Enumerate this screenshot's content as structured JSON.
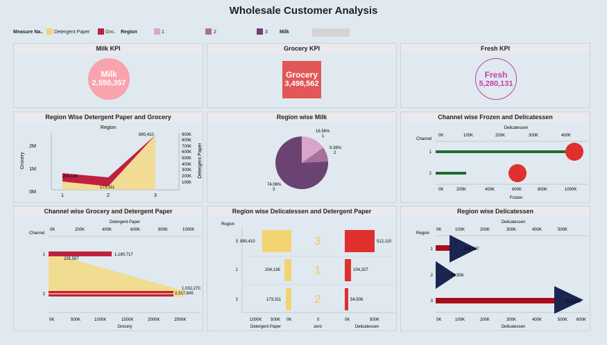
{
  "title": "Wholesale Customer Analysis",
  "legend": {
    "measure_label": "Measure Na..",
    "item1": "Detergent Paper",
    "item2": "Gro..",
    "region_label": "Region",
    "r1": "1",
    "r2": "2",
    "r3": "3",
    "milk_label": "Milk"
  },
  "colors": {
    "detergent": "#f3d473",
    "grocery": "#c0203f",
    "r1": "#d9a5c9",
    "r2": "#a9709c",
    "r3": "#6b4373",
    "milk_kpi": "#f9a3ae",
    "grocery_kpi": "#e25757",
    "fresh_kpi": "#c43ea8",
    "frozen_bar": "#1f6b2f",
    "deli_circle": "#e0302e",
    "deli_bar": "#cc3333",
    "deli_tri": "#1a2550",
    "dark_red": "#a70d1b"
  },
  "kpis": [
    {
      "header": "Milk KPI",
      "label": "Milk",
      "value": "2,550,357"
    },
    {
      "header": "Grocery KPI",
      "label": "Grocery",
      "value": "3,498,562"
    },
    {
      "header": "Fresh KPI",
      "label": "Fresh",
      "value": "5,280,131"
    }
  ],
  "panels": {
    "p4": {
      "header": "Region Wise Detergent Paper and Grocery",
      "top": "Region",
      "ylabel": "Grocery",
      "y2label": "Detergent Paper",
      "yticks": [
        "2M",
        "1M",
        "0M"
      ],
      "y2ticks": [
        "900K",
        "800K",
        "700K",
        "600K",
        "500K",
        "400K",
        "300K",
        "200K",
        "100K"
      ],
      "xticks": [
        "1",
        "2",
        "3"
      ],
      "labels": [
        "204,136",
        "173,311",
        "890,410"
      ]
    },
    "p5": {
      "header": "Region wise Milk",
      "l1": "16.56%",
      "l1b": "1",
      "l2": "9.38%",
      "l2b": "2",
      "l3": "74.06%",
      "l3b": "3"
    },
    "p6": {
      "header": "Channel wise Frozen and Delicatessen",
      "top": "Delicatessen",
      "axis_title": "Channel",
      "bottom": "Frozen",
      "ticks_top": [
        "0K",
        "100K",
        "200K",
        "300K",
        "400K"
      ],
      "ticks_bot": [
        "0K",
        "200K",
        "400K",
        "600K",
        "800K",
        "1000K"
      ],
      "rows": [
        "1",
        "2"
      ]
    },
    "p7": {
      "header": "Channel wise Grocery and Detergent Paper",
      "top": "Detergent Paper",
      "axis_title": "Channel",
      "bottom": "Grocery",
      "ticks_top": [
        "0K",
        "200K",
        "400K",
        "600K",
        "800K",
        "1000K"
      ],
      "ticks_bot": [
        "0K",
        "500K",
        "1000K",
        "1500K",
        "2000K",
        "2500K"
      ],
      "rows": [
        "1",
        "2"
      ],
      "labels": [
        "1,180,717",
        "235,587",
        "1,032,270",
        "2,317,845"
      ]
    },
    "p8": {
      "header": "Region wise Delicatessen and Detergent Paper",
      "axis_title": "Region",
      "rows": [
        "3",
        "1",
        "2"
      ],
      "det": [
        "890,410",
        "204,136",
        "173,311"
      ],
      "deli": [
        "512,110",
        "104,327",
        "54,506"
      ],
      "x1": [
        "1000K",
        "500K",
        "0K"
      ],
      "x2": [
        "0",
        "0K",
        "500K"
      ],
      "b1": "Detergent Paper",
      "b2": "zero",
      "b3": "Delicatessen"
    },
    "p9": {
      "header": "Region wise Delicatessen",
      "top": "Delicatessen",
      "axis_title": "Region",
      "bottom": "Delicatessen",
      "ticks": [
        "0K",
        "100K",
        "200K",
        "300K",
        "400K",
        "500K",
        "600K"
      ],
      "rows": [
        "1",
        "2",
        "3"
      ],
      "labels": [
        "104,327",
        "54,506",
        "512,110"
      ]
    }
  },
  "chart_data": [
    {
      "type": "bar",
      "title": "Milk KPI",
      "categories": [
        "Milk"
      ],
      "values": [
        2550357
      ]
    },
    {
      "type": "bar",
      "title": "Grocery KPI",
      "categories": [
        "Grocery"
      ],
      "values": [
        3498562
      ]
    },
    {
      "type": "bar",
      "title": "Fresh KPI",
      "categories": [
        "Fresh"
      ],
      "values": [
        5280131
      ]
    },
    {
      "type": "area",
      "title": "Region Wise Detergent Paper and Grocery",
      "xlabel": "Region",
      "categories": [
        "1",
        "2",
        "3"
      ],
      "series": [
        {
          "name": "Detergent Paper",
          "values": [
            204136,
            173311,
            890410
          ]
        },
        {
          "name": "Grocery",
          "values": [
            570000,
            433000,
            2496000
          ]
        }
      ]
    },
    {
      "type": "pie",
      "title": "Region wise Milk",
      "categories": [
        "1",
        "2",
        "3"
      ],
      "values": [
        16.56,
        9.38,
        74.06
      ]
    },
    {
      "type": "bar",
      "title": "Channel wise Frozen and Delicatessen",
      "categories": [
        "1",
        "2"
      ],
      "series": [
        {
          "name": "Frozen",
          "values": [
            1035000,
            230000
          ]
        },
        {
          "name": "Delicatessen",
          "values": [
            427000,
            244000
          ]
        }
      ]
    },
    {
      "type": "area",
      "title": "Channel wise Grocery and Detergent Paper",
      "categories": [
        "1",
        "2"
      ],
      "series": [
        {
          "name": "Grocery",
          "values": [
            1180717,
            2317845
          ]
        },
        {
          "name": "Detergent Paper",
          "values": [
            235587,
            1032270
          ]
        }
      ]
    },
    {
      "type": "bar",
      "title": "Region wise Delicatessen and Detergent Paper",
      "categories": [
        "3",
        "1",
        "2"
      ],
      "series": [
        {
          "name": "Detergent Paper",
          "values": [
            890410,
            204136,
            173311
          ]
        },
        {
          "name": "Delicatessen",
          "values": [
            512110,
            104327,
            54506
          ]
        }
      ]
    },
    {
      "type": "bar",
      "title": "Region wise Delicatessen",
      "xlabel": "Delicatessen",
      "categories": [
        "1",
        "2",
        "3"
      ],
      "values": [
        104327,
        54506,
        512110
      ]
    }
  ]
}
